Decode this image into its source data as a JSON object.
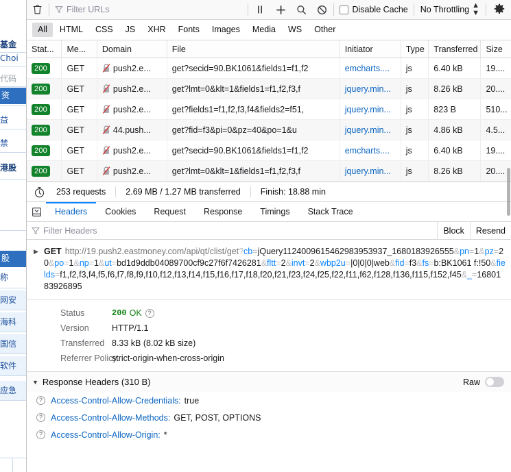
{
  "background_page": {
    "fragments": [
      {
        "text": "基金",
        "style": "dark"
      },
      {
        "text": "Choi",
        "style": "blue"
      },
      {
        "text": "代码",
        "style": "grey"
      },
      {
        "text": "资",
        "style": "band"
      },
      {
        "text": "益",
        "style": "blue"
      },
      {
        "text": "禁",
        "style": "blue"
      },
      {
        "text": "港股",
        "style": "dark"
      },
      {
        "text": "股",
        "style": "band2"
      },
      {
        "text": "称",
        "style": "blue"
      },
      {
        "text": "网安",
        "style": "blue"
      },
      {
        "text": "海科",
        "style": "blue"
      },
      {
        "text": "国信",
        "style": "blue"
      },
      {
        "text": "软件",
        "style": "blue"
      },
      {
        "text": "应急",
        "style": "blue"
      }
    ]
  },
  "toolbar": {
    "clear_icon": "trash-icon",
    "filter_urls_placeholder": "Filter URLs",
    "pause_icon": "pause-icon",
    "new_request_icon": "plus-icon",
    "search_icon": "search-icon",
    "block_icon": "block-icon",
    "disable_cache_label": "Disable Cache",
    "disable_cache_checked": false,
    "throttling_label": "No Throttling",
    "settings_icon": "gear-icon"
  },
  "type_filters": {
    "items": [
      "All",
      "HTML",
      "CSS",
      "JS",
      "XHR",
      "Fonts",
      "Images",
      "Media",
      "WS",
      "Other"
    ],
    "active": "All"
  },
  "request_table": {
    "columns": [
      "Stat...",
      "Me...",
      "Domain",
      "File",
      "Initiator",
      "Type",
      "Transferred",
      "Size"
    ],
    "rows": [
      {
        "status": "200",
        "method": "GET",
        "domain": "push2.e...",
        "file": "get?secid=90.BK1061&fields1=f1,f2",
        "initiator": "emcharts....",
        "type": "js",
        "transferred": "6.40 kB",
        "size": "19...."
      },
      {
        "status": "200",
        "method": "GET",
        "domain": "push2.e...",
        "file": "get?lmt=0&klt=1&fields1=f1,f2,f3,f",
        "initiator": "jquery.min...",
        "type": "js",
        "transferred": "8.26 kB",
        "size": "20...."
      },
      {
        "status": "200",
        "method": "GET",
        "domain": "push2.e...",
        "file": "get?fields1=f1,f2,f3,f4&fields2=f51,",
        "initiator": "jquery.min...",
        "type": "js",
        "transferred": "823 B",
        "size": "510..."
      },
      {
        "status": "200",
        "method": "GET",
        "domain": "44.push...",
        "file": "get?fid=f3&pi=0&pz=40&po=1&u",
        "initiator": "jquery.min...",
        "type": "js",
        "transferred": "4.86 kB",
        "size": "4.5..."
      },
      {
        "status": "200",
        "method": "GET",
        "domain": "push2.e...",
        "file": "get?secid=90.BK1061&fields1=f1,f2",
        "initiator": "emcharts....",
        "type": "js",
        "transferred": "6.40 kB",
        "size": "19...."
      },
      {
        "status": "200",
        "method": "GET",
        "domain": "push2.e...",
        "file": "get?lmt=0&klt=1&fields1=f1,f2,f3,f",
        "initiator": "jquery.min...",
        "type": "js",
        "transferred": "8.26 kB",
        "size": "20...."
      }
    ]
  },
  "summary": {
    "requests": "253 requests",
    "transferred": "2.69 MB / 1.27 MB transferred",
    "finish": "Finish: 18.88 min",
    "timer_icon": "stopwatch-icon"
  },
  "detail_tabs": {
    "panel_toggle_icon": "panel-toggle-icon",
    "items": [
      "Headers",
      "Cookies",
      "Request",
      "Response",
      "Timings",
      "Stack Trace"
    ],
    "active": "Headers"
  },
  "filter_headers": {
    "placeholder": "Filter Headers",
    "block_label": "Block",
    "resend_label": "Resend"
  },
  "request_url": {
    "method": "GET",
    "base": "http://19.push2.eastmoney.com/api/qt/clist/get",
    "segments": [
      {
        "sep": "?",
        "key": "cb",
        "value": "jQuery1124009615462983953937_1680183926555"
      },
      {
        "sep": "&",
        "key": "pn",
        "value": "1"
      },
      {
        "sep": "&",
        "key": "pz",
        "value": "20"
      },
      {
        "sep": "&",
        "key": "po",
        "value": "1"
      },
      {
        "sep": "&",
        "key": "np",
        "value": "1"
      },
      {
        "sep": "&",
        "key": "ut",
        "value": "bd1d9ddb04089700cf9c27f6f7426281"
      },
      {
        "sep": "&",
        "key": "fltt",
        "value": "2"
      },
      {
        "sep": "&",
        "key": "invt",
        "value": "2"
      },
      {
        "sep": "&",
        "key": "wbp2u",
        "value": "|0|0|0|web"
      },
      {
        "sep": "&",
        "key": "fid",
        "value": "f3"
      },
      {
        "sep": "&",
        "key": "fs",
        "value": "b:BK1061 f:!50"
      },
      {
        "sep": "&",
        "key": "fields",
        "value": "f1,f2,f3,f4,f5,f6,f7,f8,f9,f10,f12,f13,f14,f15,f16,f17,f18,f20,f21,f23,f24,f25,f22,f11,f62,f128,f136,f115,f152,f45"
      },
      {
        "sep": "&",
        "key": "_",
        "value": "1680183926895"
      }
    ]
  },
  "status_details": {
    "rows": [
      {
        "label": "Status",
        "value": "200 OK",
        "code": "200",
        "ok": "OK",
        "has_help": true
      },
      {
        "label": "Version",
        "value": "HTTP/1.1",
        "has_help": false
      },
      {
        "label": "Transferred",
        "value": "8.33 kB (8.02 kB size)",
        "has_help": false
      },
      {
        "label": "Referrer Policy",
        "value": "strict-origin-when-cross-origin",
        "has_help": false
      }
    ]
  },
  "response_headers": {
    "title": "Response Headers (310 B)",
    "raw_label": "Raw",
    "raw_on": false,
    "items": [
      {
        "name": "Access-Control-Allow-Credentials:",
        "value": "true"
      },
      {
        "name": "Access-Control-Allow-Methods:",
        "value": "GET, POST, OPTIONS"
      },
      {
        "name": "Access-Control-Allow-Origin:",
        "value": "*"
      }
    ]
  },
  "colors": {
    "accent": "#0a84ff",
    "status_ok": "#12822b",
    "link": "#0b65c2",
    "toolbar_bg": "#f9f9fa"
  }
}
